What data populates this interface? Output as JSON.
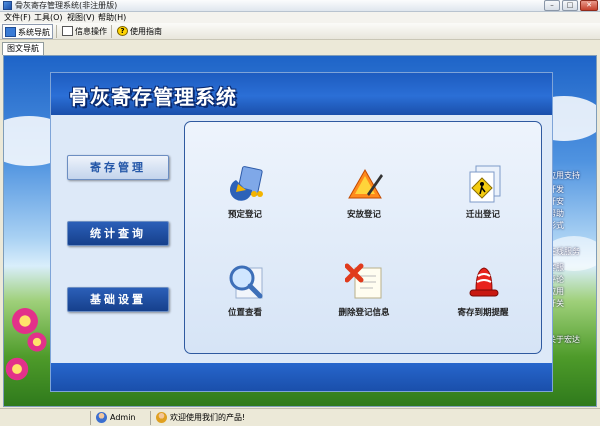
{
  "window": {
    "title": "骨灰寄存管理系统(非注册版)",
    "controls": [
      "minimize",
      "maximize",
      "close"
    ]
  },
  "menu": [
    "文件(F)",
    "工具(O)",
    "视图(V)",
    "帮助(H)"
  ],
  "toolbar": [
    {
      "label": "系统导航",
      "icon": "navigation-icon",
      "active": true
    },
    {
      "label": "信息操作",
      "icon": "info-icon",
      "active": false
    },
    {
      "label": "使用指南",
      "icon": "help-icon",
      "active": false
    }
  ],
  "tab": {
    "label": "图文导航"
  },
  "panel": {
    "title": "骨灰寄存管理系统",
    "nav": [
      {
        "label": "寄存管理",
        "selected": true
      },
      {
        "label": "统计查询",
        "selected": false
      },
      {
        "label": "基础设置",
        "selected": false
      }
    ],
    "functions": [
      {
        "label": "预定登记",
        "icon": "reserve-icon"
      },
      {
        "label": "安放登记",
        "icon": "placement-icon"
      },
      {
        "label": "迁出登记",
        "icon": "move-out-icon"
      },
      {
        "label": "位置查看",
        "icon": "magnifier-icon"
      },
      {
        "label": "删除登记信息",
        "icon": "delete-icon"
      },
      {
        "label": "寄存到期提醒",
        "icon": "alarm-bell-icon"
      }
    ]
  },
  "side_text": [
    "应用支持",
    "开发",
    "开安",
    "帮助",
    "形式",
    "在线服务",
    "客服",
    "评论",
    "应用",
    "开关",
    "关于宏达"
  ],
  "statusbar": {
    "user": "Admin",
    "message": "欢迎使用我们的产品!"
  }
}
